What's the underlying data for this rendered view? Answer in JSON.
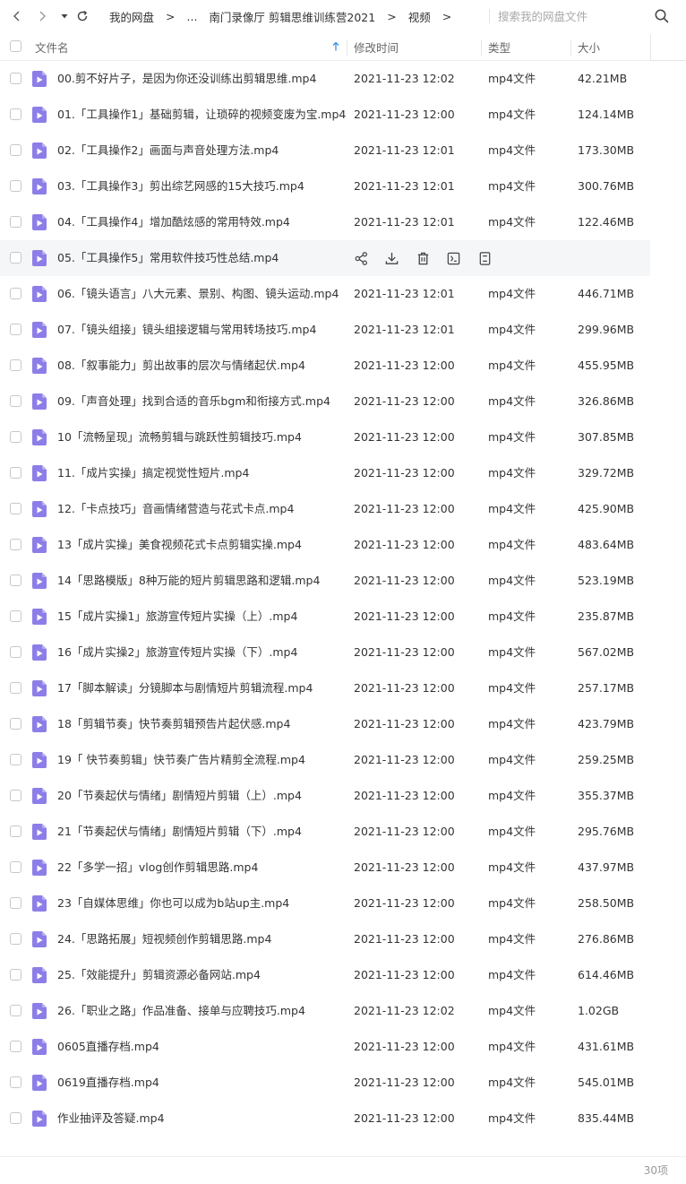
{
  "nav": {
    "back_icon": "chevron-left-icon",
    "forward_icon": "chevron-right-icon",
    "history_icon": "caret-down-icon",
    "refresh_icon": "refresh-icon"
  },
  "breadcrumb": {
    "items": [
      "我的网盘",
      "...",
      "南门录像厅 剪辑思维训练营2021",
      "视频"
    ],
    "separator": ">"
  },
  "search": {
    "placeholder": "搜索我的网盘文件",
    "value": "",
    "icon": "search-icon"
  },
  "columns": {
    "name": "文件名",
    "modified": "修改时间",
    "type": "类型",
    "size": "大小"
  },
  "colors": {
    "accent": "#3a8ee6",
    "file_icon": "#8c7ee8",
    "hover_row": "#f5f6f8"
  },
  "row_actions": [
    "share-icon",
    "download-icon",
    "delete-icon",
    "rename-icon",
    "more-icon"
  ],
  "hover_row_index": 5,
  "files": [
    {
      "name": "00.剪不好片子，是因为你还没训练出剪辑思维.mp4",
      "date": "2021-11-23 12:02",
      "type": "mp4文件",
      "size": "42.21MB"
    },
    {
      "name": "01.「工具操作1」基础剪辑，让琐碎的视频变废为宝.mp4",
      "date": "2021-11-23 12:00",
      "type": "mp4文件",
      "size": "124.14MB"
    },
    {
      "name": "02.「工具操作2」画面与声音处理方法.mp4",
      "date": "2021-11-23 12:01",
      "type": "mp4文件",
      "size": "173.30MB"
    },
    {
      "name": "03.「工具操作3」剪出综艺网感的15大技巧.mp4",
      "date": "2021-11-23 12:01",
      "type": "mp4文件",
      "size": "300.76MB"
    },
    {
      "name": "04.「工具操作4」增加酷炫感的常用特效.mp4",
      "date": "2021-11-23 12:01",
      "type": "mp4文件",
      "size": "122.46MB"
    },
    {
      "name": "05.「工具操作5」常用软件技巧性总结.mp4",
      "date": "",
      "type": "",
      "size": ""
    },
    {
      "name": "06.「镜头语言」八大元素、景别、构图、镜头运动.mp4",
      "date": "2021-11-23 12:01",
      "type": "mp4文件",
      "size": "446.71MB"
    },
    {
      "name": "07.「镜头组接」镜头组接逻辑与常用转场技巧.mp4",
      "date": "2021-11-23 12:01",
      "type": "mp4文件",
      "size": "299.96MB"
    },
    {
      "name": "08.「叙事能力」剪出故事的层次与情绪起伏.mp4",
      "date": "2021-11-23 12:00",
      "type": "mp4文件",
      "size": "455.95MB"
    },
    {
      "name": "09.「声音处理」找到合适的音乐bgm和衔接方式.mp4",
      "date": "2021-11-23 12:00",
      "type": "mp4文件",
      "size": "326.86MB"
    },
    {
      "name": "10「流畅呈现」流畅剪辑与跳跃性剪辑技巧.mp4",
      "date": "2021-11-23 12:00",
      "type": "mp4文件",
      "size": "307.85MB"
    },
    {
      "name": "11.「成片实操」搞定视觉性短片.mp4",
      "date": "2021-11-23 12:00",
      "type": "mp4文件",
      "size": "329.72MB"
    },
    {
      "name": "12.「卡点技巧」音画情绪营造与花式卡点.mp4",
      "date": "2021-11-23 12:00",
      "type": "mp4文件",
      "size": "425.90MB"
    },
    {
      "name": "13「成片实操」美食视频花式卡点剪辑实操.mp4",
      "date": "2021-11-23 12:00",
      "type": "mp4文件",
      "size": "483.64MB"
    },
    {
      "name": "14「思路模版」8种万能的短片剪辑思路和逻辑.mp4",
      "date": "2021-11-23 12:00",
      "type": "mp4文件",
      "size": "523.19MB"
    },
    {
      "name": "15「成片实操1」旅游宣传短片实操（上）.mp4",
      "date": "2021-11-23 12:00",
      "type": "mp4文件",
      "size": "235.87MB"
    },
    {
      "name": "16「成片实操2」旅游宣传短片实操（下）.mp4",
      "date": "2021-11-23 12:00",
      "type": "mp4文件",
      "size": "567.02MB"
    },
    {
      "name": "17「脚本解读」分镜脚本与剧情短片剪辑流程.mp4",
      "date": "2021-11-23 12:00",
      "type": "mp4文件",
      "size": "257.17MB"
    },
    {
      "name": "18「剪辑节奏」快节奏剪辑预告片起伏感.mp4",
      "date": "2021-11-23 12:00",
      "type": "mp4文件",
      "size": "423.79MB"
    },
    {
      "name": "19「 快节奏剪辑」快节奏广告片精剪全流程.mp4",
      "date": "2021-11-23 12:00",
      "type": "mp4文件",
      "size": "259.25MB"
    },
    {
      "name": "20「节奏起伏与情绪」剧情短片剪辑（上）.mp4",
      "date": "2021-11-23 12:00",
      "type": "mp4文件",
      "size": "355.37MB"
    },
    {
      "name": "21「节奏起伏与情绪」剧情短片剪辑（下）.mp4",
      "date": "2021-11-23 12:00",
      "type": "mp4文件",
      "size": "295.76MB"
    },
    {
      "name": "22「多学一招」vlog创作剪辑思路.mp4",
      "date": "2021-11-23 12:00",
      "type": "mp4文件",
      "size": "437.97MB"
    },
    {
      "name": "23「自媒体思维」你也可以成为b站up主.mp4",
      "date": "2021-11-23 12:00",
      "type": "mp4文件",
      "size": "258.50MB"
    },
    {
      "name": "24.「思路拓展」短视频创作剪辑思路.mp4",
      "date": "2021-11-23 12:00",
      "type": "mp4文件",
      "size": "276.86MB"
    },
    {
      "name": "25.「效能提升」剪辑资源必备网站.mp4",
      "date": "2021-11-23 12:00",
      "type": "mp4文件",
      "size": "614.46MB"
    },
    {
      "name": "26.「职业之路」作品准备、接单与应聘技巧.mp4",
      "date": "2021-11-23 12:02",
      "type": "mp4文件",
      "size": "1.02GB"
    },
    {
      "name": "0605直播存档.mp4",
      "date": "2021-11-23 12:00",
      "type": "mp4文件",
      "size": "431.61MB"
    },
    {
      "name": "0619直播存档.mp4",
      "date": "2021-11-23 12:00",
      "type": "mp4文件",
      "size": "545.01MB"
    },
    {
      "name": "作业抽评及答疑.mp4",
      "date": "2021-11-23 12:00",
      "type": "mp4文件",
      "size": "835.44MB"
    }
  ],
  "footer": {
    "count": "30项"
  }
}
